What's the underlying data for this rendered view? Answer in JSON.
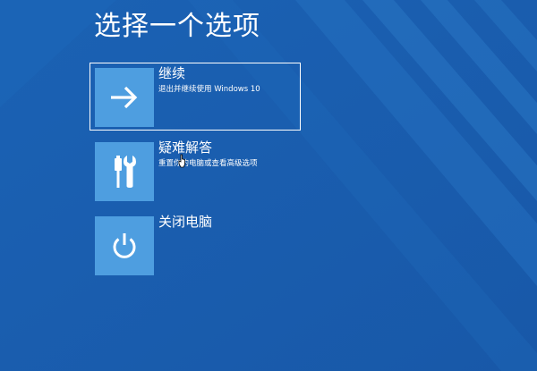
{
  "screen": {
    "title": "选择一个选项",
    "background_color": "#1a5fb0",
    "tile_color": "#4e9ee0"
  },
  "options": [
    {
      "title": "继续",
      "description": "退出并继续使用 Windows 10",
      "icon": "arrow-right-icon",
      "selected": true
    },
    {
      "title": "疑难解答",
      "description": "重置你的电脑或查看高级选项",
      "icon": "tools-icon",
      "selected": false
    },
    {
      "title": "关闭电脑",
      "description": "",
      "icon": "power-icon",
      "selected": false
    }
  ]
}
